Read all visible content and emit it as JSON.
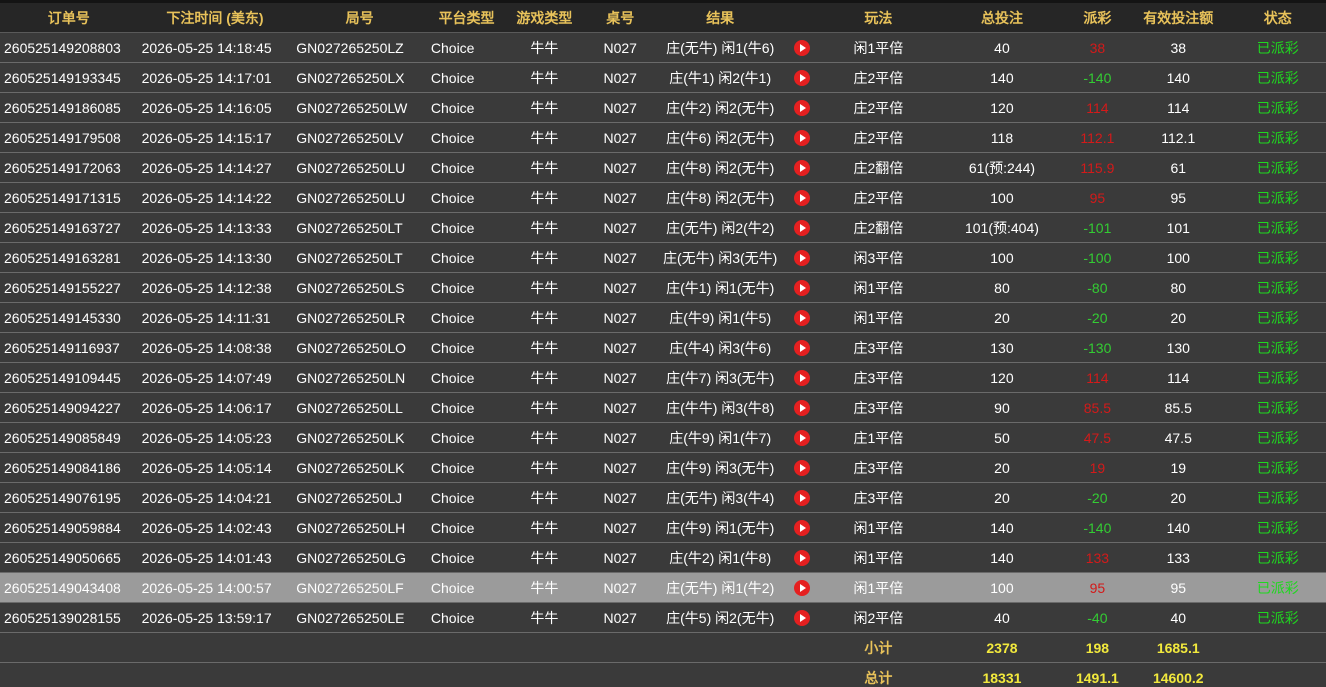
{
  "columns": [
    "订单号",
    "下注时间 (美东)",
    "局号",
    "平台类型",
    "游戏类型",
    "桌号",
    "结果",
    "",
    "玩法",
    "总投注",
    "派彩",
    "有效投注额",
    "状态"
  ],
  "rows": [
    {
      "order": "260525149208803",
      "time": "2026-05-25 14:18:45",
      "round": "GN027265250LZ",
      "platform": "Choice",
      "game": "牛牛",
      "table": "N027",
      "result": "庄(无牛) 闲1(牛6)",
      "play": "闲1平倍",
      "bet": "40",
      "payout": "38",
      "payout_sign": "pos",
      "valid": "38",
      "status": "已派彩"
    },
    {
      "order": "260525149193345",
      "time": "2026-05-25 14:17:01",
      "round": "GN027265250LX",
      "platform": "Choice",
      "game": "牛牛",
      "table": "N027",
      "result": "庄(牛1) 闲2(牛1)",
      "play": "庄2平倍",
      "bet": "140",
      "payout": "-140",
      "payout_sign": "neg",
      "valid": "140",
      "status": "已派彩"
    },
    {
      "order": "260525149186085",
      "time": "2026-05-25 14:16:05",
      "round": "GN027265250LW",
      "platform": "Choice",
      "game": "牛牛",
      "table": "N027",
      "result": "庄(牛2) 闲2(无牛)",
      "play": "庄2平倍",
      "bet": "120",
      "payout": "114",
      "payout_sign": "pos",
      "valid": "114",
      "status": "已派彩"
    },
    {
      "order": "260525149179508",
      "time": "2026-05-25 14:15:17",
      "round": "GN027265250LV",
      "platform": "Choice",
      "game": "牛牛",
      "table": "N027",
      "result": "庄(牛6) 闲2(无牛)",
      "play": "庄2平倍",
      "bet": "118",
      "payout": "112.1",
      "payout_sign": "pos",
      "valid": "112.1",
      "status": "已派彩"
    },
    {
      "order": "260525149172063",
      "time": "2026-05-25 14:14:27",
      "round": "GN027265250LU",
      "platform": "Choice",
      "game": "牛牛",
      "table": "N027",
      "result": "庄(牛8) 闲2(无牛)",
      "play": "庄2翻倍",
      "bet": "61(预:244)",
      "payout": "115.9",
      "payout_sign": "pos",
      "valid": "61",
      "status": "已派彩"
    },
    {
      "order": "260525149171315",
      "time": "2026-05-25 14:14:22",
      "round": "GN027265250LU",
      "platform": "Choice",
      "game": "牛牛",
      "table": "N027",
      "result": "庄(牛8) 闲2(无牛)",
      "play": "庄2平倍",
      "bet": "100",
      "payout": "95",
      "payout_sign": "pos",
      "valid": "95",
      "status": "已派彩"
    },
    {
      "order": "260525149163727",
      "time": "2026-05-25 14:13:33",
      "round": "GN027265250LT",
      "platform": "Choice",
      "game": "牛牛",
      "table": "N027",
      "result": "庄(无牛) 闲2(牛2)",
      "play": "庄2翻倍",
      "bet": "101(预:404)",
      "payout": "-101",
      "payout_sign": "neg",
      "valid": "101",
      "status": "已派彩"
    },
    {
      "order": "260525149163281",
      "time": "2026-05-25 14:13:30",
      "round": "GN027265250LT",
      "platform": "Choice",
      "game": "牛牛",
      "table": "N027",
      "result": "庄(无牛) 闲3(无牛)",
      "play": "闲3平倍",
      "bet": "100",
      "payout": "-100",
      "payout_sign": "neg",
      "valid": "100",
      "status": "已派彩"
    },
    {
      "order": "260525149155227",
      "time": "2026-05-25 14:12:38",
      "round": "GN027265250LS",
      "platform": "Choice",
      "game": "牛牛",
      "table": "N027",
      "result": "庄(牛1) 闲1(无牛)",
      "play": "闲1平倍",
      "bet": "80",
      "payout": "-80",
      "payout_sign": "neg",
      "valid": "80",
      "status": "已派彩"
    },
    {
      "order": "260525149145330",
      "time": "2026-05-25 14:11:31",
      "round": "GN027265250LR",
      "platform": "Choice",
      "game": "牛牛",
      "table": "N027",
      "result": "庄(牛9) 闲1(牛5)",
      "play": "闲1平倍",
      "bet": "20",
      "payout": "-20",
      "payout_sign": "neg",
      "valid": "20",
      "status": "已派彩"
    },
    {
      "order": "260525149116937",
      "time": "2026-05-25 14:08:38",
      "round": "GN027265250LO",
      "platform": "Choice",
      "game": "牛牛",
      "table": "N027",
      "result": "庄(牛4) 闲3(牛6)",
      "play": "庄3平倍",
      "bet": "130",
      "payout": "-130",
      "payout_sign": "neg",
      "valid": "130",
      "status": "已派彩"
    },
    {
      "order": "260525149109445",
      "time": "2026-05-25 14:07:49",
      "round": "GN027265250LN",
      "platform": "Choice",
      "game": "牛牛",
      "table": "N027",
      "result": "庄(牛7) 闲3(无牛)",
      "play": "庄3平倍",
      "bet": "120",
      "payout": "114",
      "payout_sign": "pos",
      "valid": "114",
      "status": "已派彩"
    },
    {
      "order": "260525149094227",
      "time": "2026-05-25 14:06:17",
      "round": "GN027265250LL",
      "platform": "Choice",
      "game": "牛牛",
      "table": "N027",
      "result": "庄(牛牛) 闲3(牛8)",
      "play": "庄3平倍",
      "bet": "90",
      "payout": "85.5",
      "payout_sign": "pos",
      "valid": "85.5",
      "status": "已派彩"
    },
    {
      "order": "260525149085849",
      "time": "2026-05-25 14:05:23",
      "round": "GN027265250LK",
      "platform": "Choice",
      "game": "牛牛",
      "table": "N027",
      "result": "庄(牛9) 闲1(牛7)",
      "play": "庄1平倍",
      "bet": "50",
      "payout": "47.5",
      "payout_sign": "pos",
      "valid": "47.5",
      "status": "已派彩"
    },
    {
      "order": "260525149084186",
      "time": "2026-05-25 14:05:14",
      "round": "GN027265250LK",
      "platform": "Choice",
      "game": "牛牛",
      "table": "N027",
      "result": "庄(牛9) 闲3(无牛)",
      "play": "庄3平倍",
      "bet": "20",
      "payout": "19",
      "payout_sign": "pos",
      "valid": "19",
      "status": "已派彩"
    },
    {
      "order": "260525149076195",
      "time": "2026-05-25 14:04:21",
      "round": "GN027265250LJ",
      "platform": "Choice",
      "game": "牛牛",
      "table": "N027",
      "result": "庄(无牛) 闲3(牛4)",
      "play": "庄3平倍",
      "bet": "20",
      "payout": "-20",
      "payout_sign": "neg",
      "valid": "20",
      "status": "已派彩"
    },
    {
      "order": "260525149059884",
      "time": "2026-05-25 14:02:43",
      "round": "GN027265250LH",
      "platform": "Choice",
      "game": "牛牛",
      "table": "N027",
      "result": "庄(牛9) 闲1(无牛)",
      "play": "闲1平倍",
      "bet": "140",
      "payout": "-140",
      "payout_sign": "neg",
      "valid": "140",
      "status": "已派彩"
    },
    {
      "order": "260525149050665",
      "time": "2026-05-25 14:01:43",
      "round": "GN027265250LG",
      "platform": "Choice",
      "game": "牛牛",
      "table": "N027",
      "result": "庄(牛2) 闲1(牛8)",
      "play": "闲1平倍",
      "bet": "140",
      "payout": "133",
      "payout_sign": "pos",
      "valid": "133",
      "status": "已派彩"
    },
    {
      "order": "260525149043408",
      "time": "2026-05-25 14:00:57",
      "round": "GN027265250LF",
      "platform": "Choice",
      "game": "牛牛",
      "table": "N027",
      "result": "庄(无牛) 闲1(牛2)",
      "play": "闲1平倍",
      "bet": "100",
      "payout": "95",
      "payout_sign": "pos",
      "valid": "95",
      "status": "已派彩",
      "highlighted": true
    },
    {
      "order": "260525139028155",
      "time": "2026-05-25 13:59:17",
      "round": "GN027265250LE",
      "platform": "Choice",
      "game": "牛牛",
      "table": "N027",
      "result": "庄(牛5) 闲2(无牛)",
      "play": "闲2平倍",
      "bet": "40",
      "payout": "-40",
      "payout_sign": "neg",
      "valid": "40",
      "status": "已派彩"
    }
  ],
  "subtotal": {
    "label": "小计",
    "bet": "2378",
    "payout": "198",
    "valid": "1685.1"
  },
  "total": {
    "label": "总计",
    "bet": "18331",
    "payout": "1491.1",
    "valid": "14600.2"
  },
  "icons": {
    "replay": "play-circle-icon"
  },
  "colors": {
    "header_text": "#e8c25a",
    "positive_payout": "#d31a1a",
    "negative_payout": "#33cc33",
    "status": "#1fd81f",
    "totals": "#f2e93d",
    "replay_icon": "#e52020",
    "highlight_row": "#9b9b9b"
  }
}
